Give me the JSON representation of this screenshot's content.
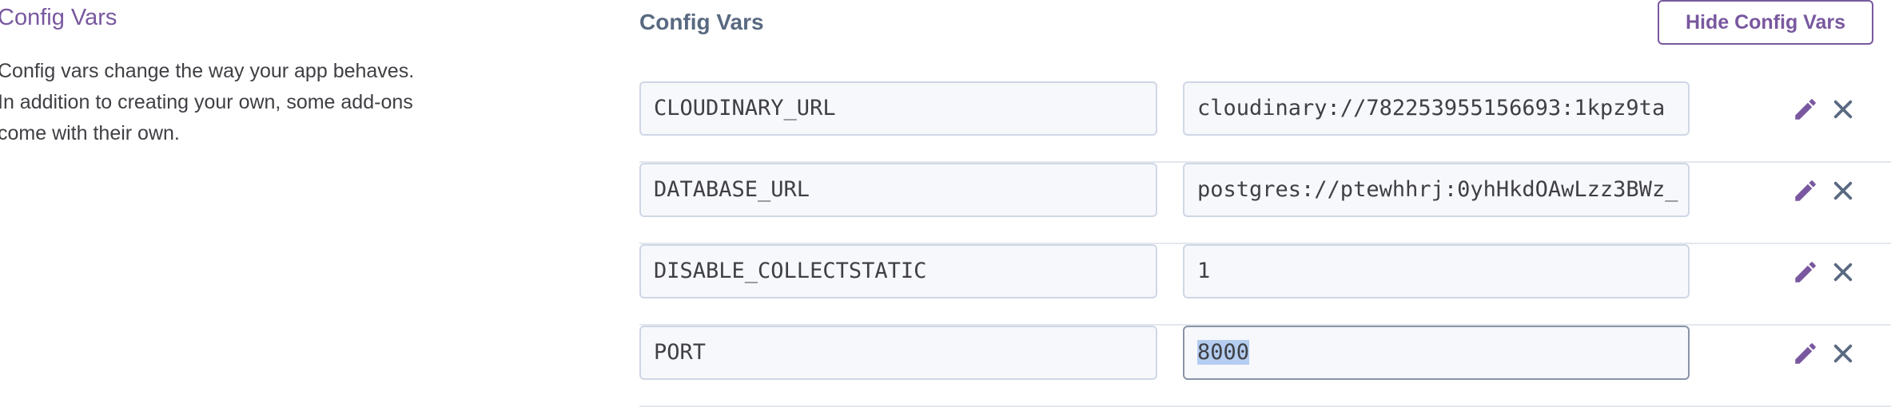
{
  "left": {
    "title": "Config Vars",
    "description": "Config vars change the way your app behaves. In addition to creating your own, some add-ons come with their own."
  },
  "section": {
    "title": "Config Vars",
    "hide_button": "Hide Config Vars"
  },
  "config_vars": [
    {
      "key": "CLOUDINARY_URL",
      "value": "cloudinary://782253955156693:1kpz9ta"
    },
    {
      "key": "DATABASE_URL",
      "value": "postgres://ptewhhrj:0yhHkdOAwLzz3BWz_"
    },
    {
      "key": "DISABLE_COLLECTSTATIC",
      "value": "1"
    },
    {
      "key": "PORT",
      "value": "8000"
    }
  ],
  "icons": {
    "edit": "pencil-icon",
    "delete": "close-icon"
  },
  "colors": {
    "accent": "#79589f",
    "heading": "#596981",
    "field_border": "#cfd7e6",
    "selection": "#b4cdf0"
  }
}
